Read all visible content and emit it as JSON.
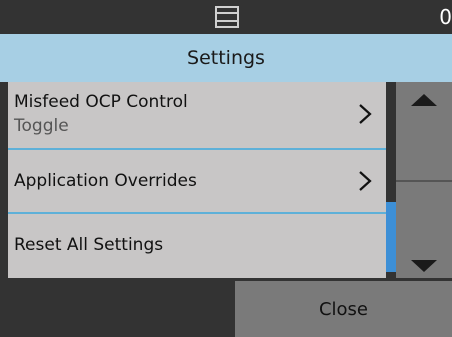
{
  "status_bar": {
    "icon": "scanner-icon",
    "counter": "0"
  },
  "header": {
    "title": "Settings"
  },
  "settings_list": {
    "items": [
      {
        "label": "Misfeed OCP Control",
        "value": "Toggle",
        "icon": "chevron-right-icon"
      },
      {
        "label": "Application Overrides",
        "icon": "chevron-right-icon"
      },
      {
        "label": "Reset All Settings"
      }
    ]
  },
  "scrollbar": {
    "up_icon": "arrow-up-icon",
    "down_icon": "arrow-down-icon",
    "thumb_color": "#3d8fd6",
    "position": "bottom"
  },
  "footer": {
    "close_label": "Close"
  },
  "colors": {
    "background": "#333333",
    "header": "#a7cfe4",
    "list_item": "#c8c6c6",
    "separator": "#5eb0d8",
    "button": "#7a7a7a"
  }
}
